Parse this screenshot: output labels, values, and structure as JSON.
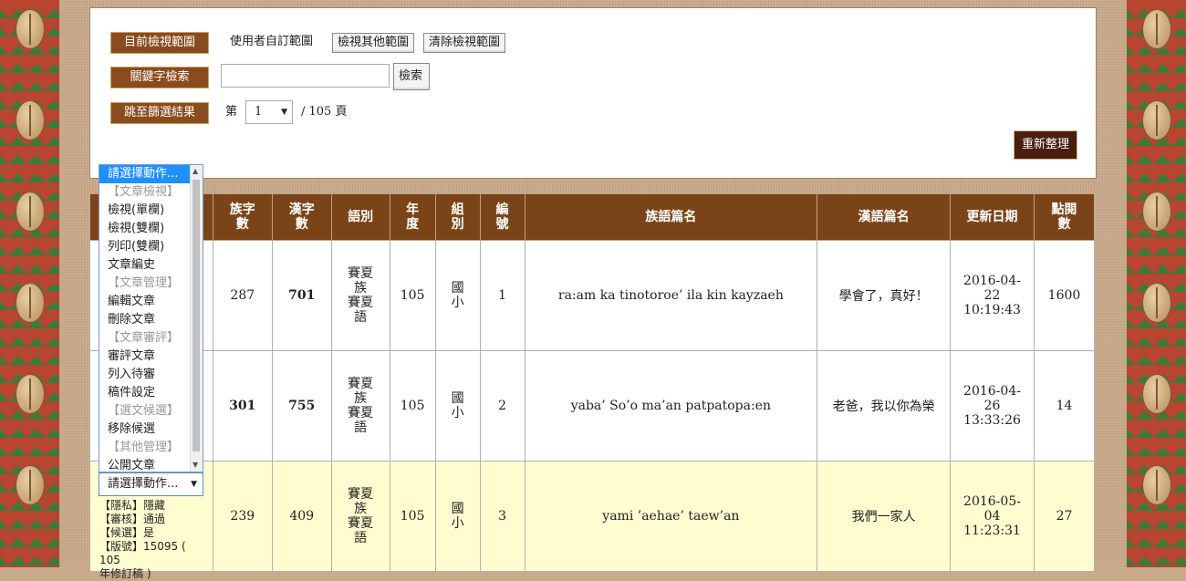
{
  "filters": {
    "range_label": "目前檢視範圍",
    "range_value": "使用者自訂範圍",
    "view_other_btn": "檢視其他範圍",
    "clear_btn": "清除檢視範圍",
    "keyword_label": "關鍵字檢索",
    "keyword_value": "",
    "search_btn": "檢索",
    "jump_label": "跳至篩選結果",
    "page_prefix": "第",
    "page_value": "1",
    "page_suffix": "/ 105 頁",
    "reorganize_btn": "重新整理"
  },
  "table": {
    "headers": [
      "族字數",
      "漢字數",
      "語別",
      "年度",
      "組別",
      "編號",
      "族語篇名",
      "漢語篇名",
      "更新日期",
      "點閱數"
    ],
    "header_lines": {
      "h0a": "族字",
      "h0b": "數",
      "h1a": "漢字",
      "h1b": "數",
      "h2": "語別",
      "h3a": "年",
      "h3b": "度",
      "h4a": "組",
      "h4b": "別",
      "h5a": "編",
      "h5b": "號",
      "h6": "族語篇名",
      "h7": "漢語篇名",
      "h8": "更新日期",
      "h9a": "點閱",
      "h9b": "數"
    },
    "rows": [
      {
        "zu": "287",
        "han": "701",
        "lang1": "賽夏",
        "lang2": "族",
        "lang3": "賽夏",
        "lang4": "語",
        "year": "105",
        "grp1": "國",
        "grp2": "小",
        "no": "1",
        "zu_title": "ra:am ka tinotoroe’ ila kin kayzaeh",
        "han_title": "學會了，真好！",
        "date1": "2016-04-",
        "date2": "22",
        "date3": "10:19:43",
        "views": "1600"
      },
      {
        "zu": "301",
        "han": "755",
        "lang1": "賽夏",
        "lang2": "族",
        "lang3": "賽夏",
        "lang4": "語",
        "year": "105",
        "grp1": "國",
        "grp2": "小",
        "no": "2",
        "zu_title": "yaba’ So’o ma’an patpatopa:en",
        "han_title": "老爸，我以你為榮",
        "date1": "2016-04-",
        "date2": "26",
        "date3": "13:33:26",
        "views": "14"
      },
      {
        "zu": "239",
        "han": "409",
        "lang1": "賽夏",
        "lang2": "族",
        "lang3": "賽夏",
        "lang4": "語",
        "year": "105",
        "grp1": "國",
        "grp2": "小",
        "no": "3",
        "zu_title": "yami ’aehae’ taew’an",
        "han_title": "我們一家人",
        "date1": "2016-05-",
        "date2": "04",
        "date3": "11:23:31",
        "views": "27"
      }
    ]
  },
  "action_menu": {
    "items": [
      {
        "label": "請選擇動作...",
        "kind": "selected"
      },
      {
        "label": "【文章檢視】",
        "kind": "group"
      },
      {
        "label": "檢視(單欄)",
        "kind": "item"
      },
      {
        "label": "檢視(雙欄)",
        "kind": "item"
      },
      {
        "label": "列印(雙欄)",
        "kind": "item"
      },
      {
        "label": "文章編史",
        "kind": "item"
      },
      {
        "label": "【文章管理】",
        "kind": "group"
      },
      {
        "label": "編輯文章",
        "kind": "item"
      },
      {
        "label": "刪除文章",
        "kind": "item"
      },
      {
        "label": "【文章審評】",
        "kind": "group"
      },
      {
        "label": "審評文章",
        "kind": "item"
      },
      {
        "label": "列入待審",
        "kind": "item"
      },
      {
        "label": "稿件設定",
        "kind": "item"
      },
      {
        "label": "【選文候選】",
        "kind": "group"
      },
      {
        "label": "移除候選",
        "kind": "item"
      },
      {
        "label": "【其他管理】",
        "kind": "group"
      },
      {
        "label": "公開文章",
        "kind": "item"
      }
    ],
    "closed_label": "請選擇動作..."
  },
  "row3_info": {
    "privacy": "【隱私】隱藏",
    "review": "【審核】通過",
    "candidate": "【候選】是",
    "version": "【版號】15095 ( 105",
    "version2": "年修訂稿 )"
  },
  "colors": {
    "header_brown": "#7a4418",
    "tag_brown": "#8a4b1e",
    "highlight_red": "#c00000",
    "row_yellow": "#fffdd0"
  }
}
